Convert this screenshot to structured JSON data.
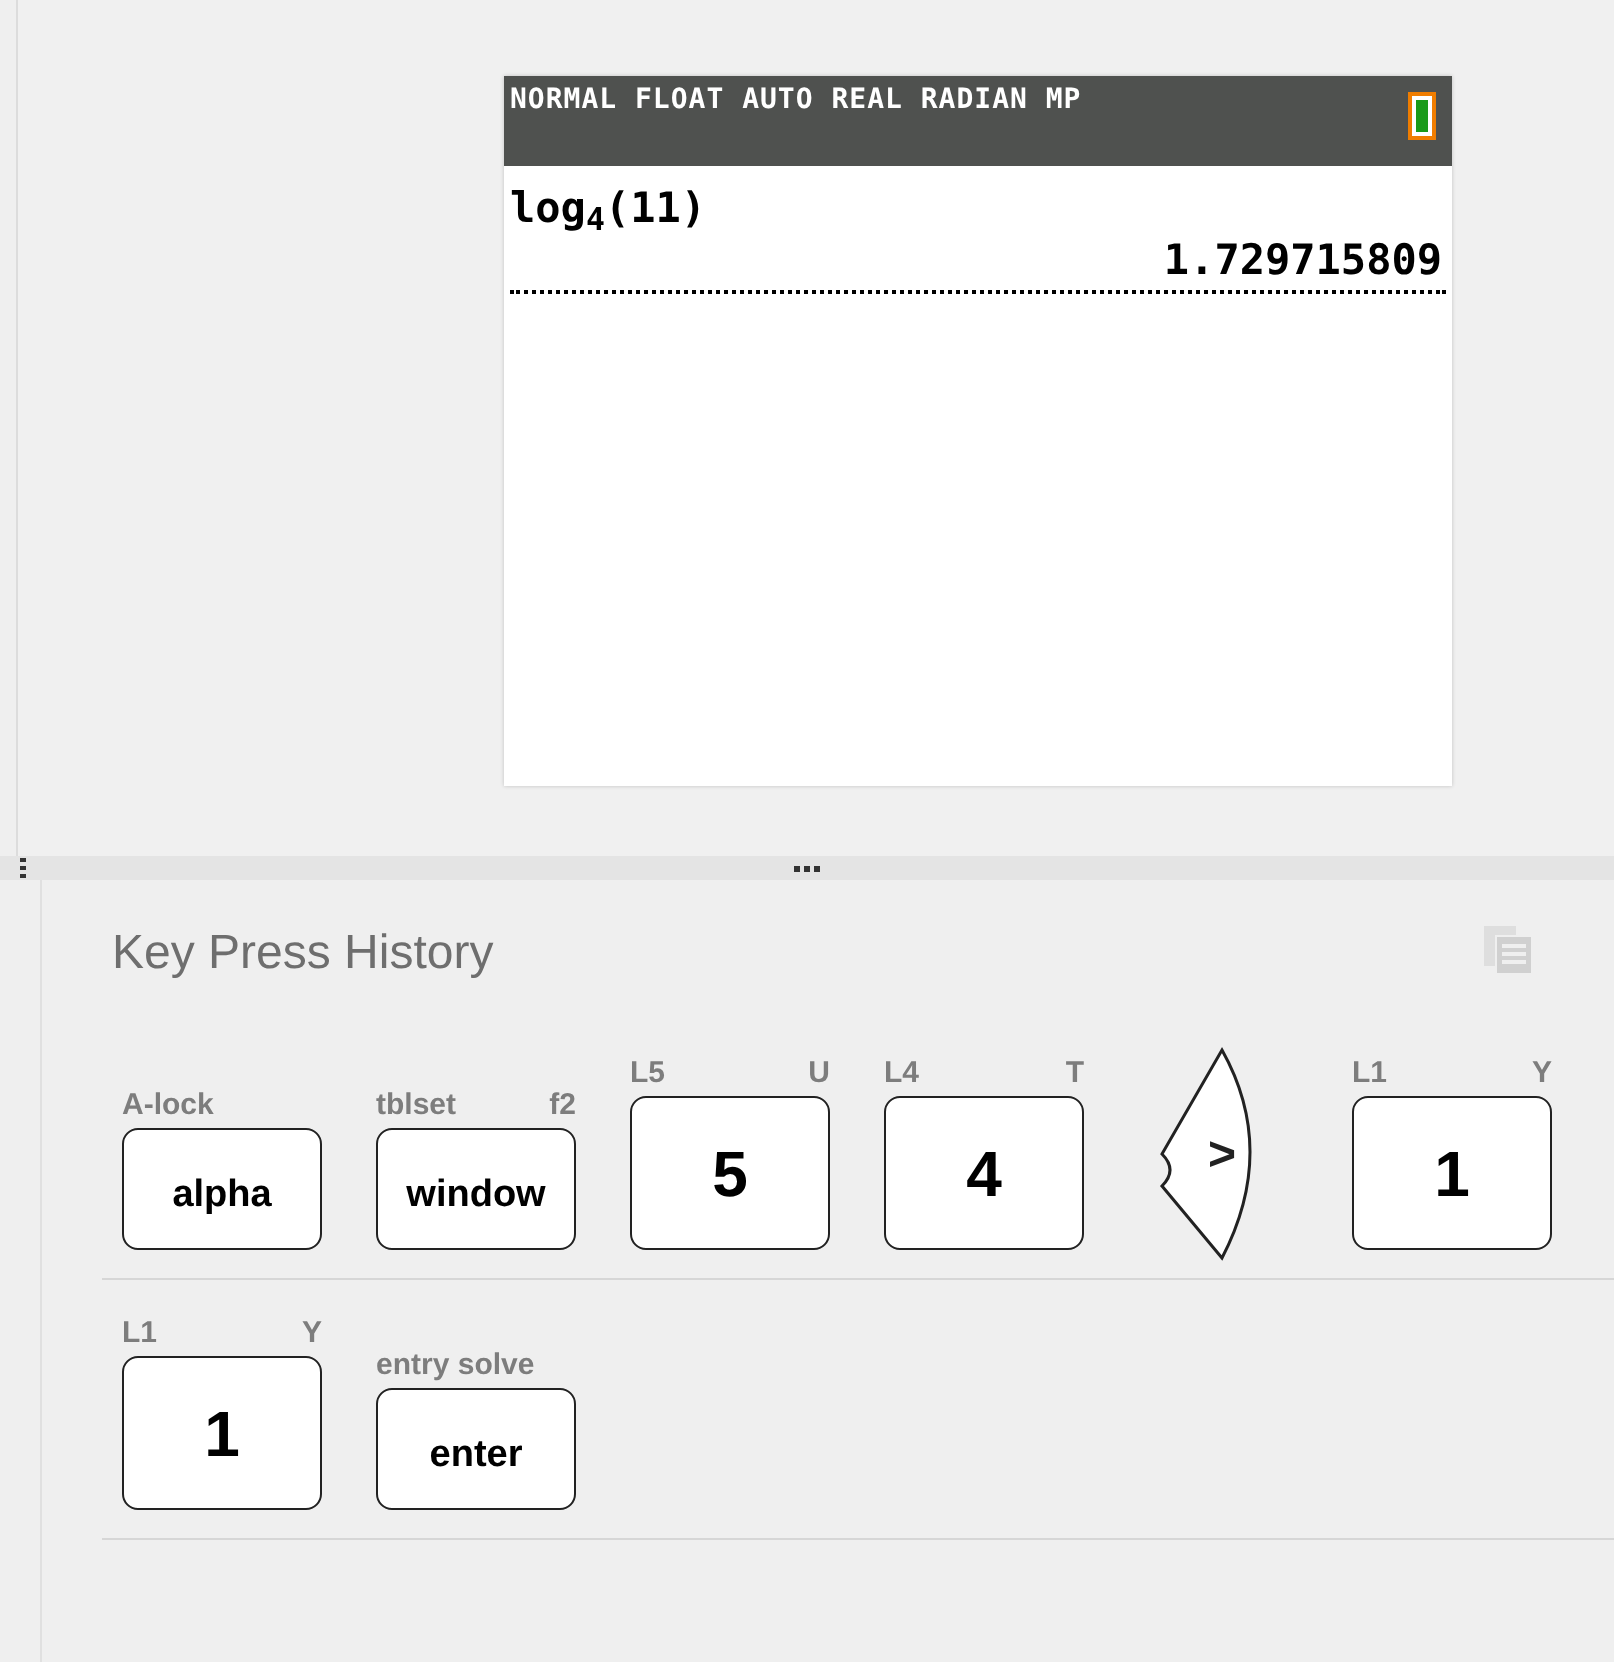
{
  "calculator_screen": {
    "status_bar": "NORMAL FLOAT AUTO REAL RADIAN MP",
    "history": [
      {
        "expression": "log$_{4}$(11)",
        "result": "1.729715809"
      }
    ]
  },
  "panel": {
    "title": "Key Press History",
    "rows": [
      {
        "keys": [
          {
            "kind": "text",
            "label": "alpha",
            "second": "A-lock"
          },
          {
            "kind": "text",
            "label": "window",
            "second": "tblset",
            "alpha": "f2"
          },
          {
            "kind": "number",
            "label": "5",
            "second": "L5",
            "alpha": "U"
          },
          {
            "kind": "number",
            "label": "4",
            "second": "L4",
            "alpha": "T"
          },
          {
            "kind": "arrow",
            "label": ">"
          },
          {
            "kind": "number",
            "label": "1",
            "second": "L1",
            "alpha": "Y"
          }
        ]
      },
      {
        "keys": [
          {
            "kind": "number",
            "label": "1",
            "second": "L1",
            "alpha": "Y"
          },
          {
            "kind": "text",
            "label": "enter",
            "second": "entry solve"
          }
        ]
      }
    ]
  }
}
